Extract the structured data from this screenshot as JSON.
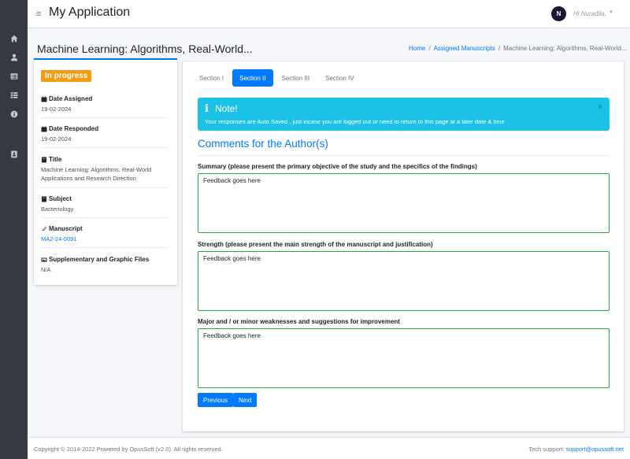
{
  "header": {
    "app_title": "My Application",
    "avatar_initial": "N",
    "greeting": "Hi Nuradila,"
  },
  "sidebar": {
    "items": [
      {
        "icon": "home-icon"
      },
      {
        "icon": "user-icon"
      },
      {
        "icon": "list-alt-icon"
      },
      {
        "icon": "th-list-icon"
      },
      {
        "icon": "info-circle-icon"
      },
      {
        "icon": "address-book-icon"
      }
    ]
  },
  "page": {
    "title": "Machine Learning: Algorithms, Real-World...",
    "breadcrumb": {
      "home": "Home",
      "assigned": "Assigned Manuscripts",
      "current": "Machine Learning: Algorithms, Real-World..."
    }
  },
  "info": {
    "status": "In progress",
    "date_assigned_label": "Date Assigned",
    "date_assigned": "19-02-2024",
    "date_responded_label": "Date Responded",
    "date_responded": "19-02-2024",
    "title_label": "Title",
    "title_line1": "Machine Learning: Algorithms, Real-World",
    "title_line2": "Applications and Research Direction",
    "subject_label": "Subject",
    "subject": "Bacteriology",
    "manuscript_label": "Manuscript",
    "manuscript": "MA2-24-0091",
    "files_label": "Supplementary and Graphic Files",
    "files": "N/A"
  },
  "tabs": [
    "Section I",
    "Section II",
    "Section III",
    "Section IV"
  ],
  "active_tab": "Section II",
  "alert": {
    "title": "Note!",
    "body": "Your responses are Auto Saved , just incase you are logged out or need to return to this page at a later date & time",
    "close": "×"
  },
  "form": {
    "section_title": "Comments for the Author(s)",
    "q1_label": "Summary (please present the primary objective of the study and the specifics of the findings)",
    "q1_value": "Feedback goes here",
    "q2_label": "Strength (please present the main strength of the manuscript and justification)",
    "q2_value": "Feedback goes here",
    "q3_label": "Major and / or minor weaknesses and suggestions for improvement",
    "q3_value": "Feedback goes here",
    "previous_label": "Previous",
    "next_label": "Next"
  },
  "footer": {
    "copyright": "Copyright © 2014-2022 Powered by OpusSoft (v2.0). All rights reserved.",
    "support_label": "Tech support:",
    "support_email": "support@opussoft.net"
  },
  "colors": {
    "primary": "#007bff",
    "status_badge": "#f39c12",
    "alert_bg": "#1cc1e6",
    "sidebar_bg": "#343a40",
    "field_border": "#28a745"
  }
}
